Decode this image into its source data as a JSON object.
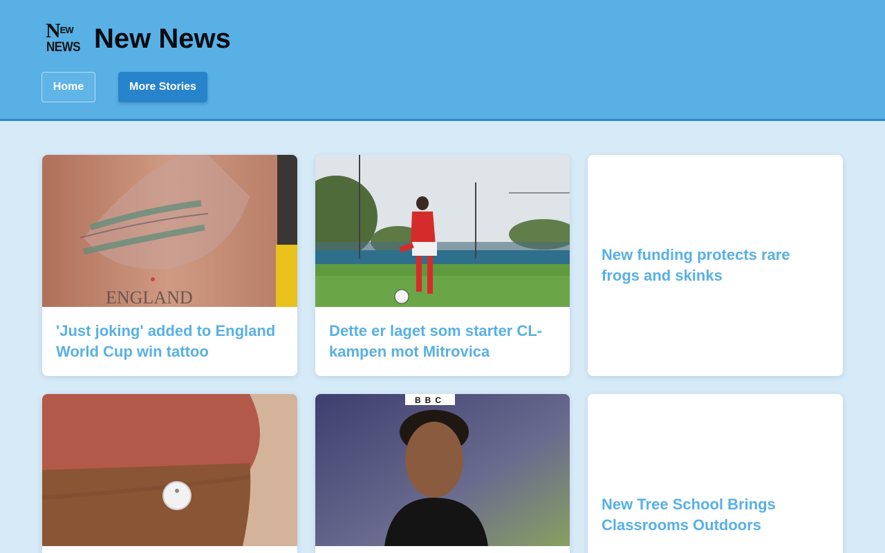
{
  "header": {
    "logo_line1_big": "N",
    "logo_line1_small": "EW",
    "logo_line2": "NEWS",
    "title": "New News",
    "nav": {
      "home_label": "Home",
      "more_label": "More Stories"
    }
  },
  "colors": {
    "header_bg": "#58b0e5",
    "page_bg": "#d6eaf8",
    "accent": "#2784cb",
    "headline": "#58b0e5"
  },
  "stories": [
    {
      "headline": "'Just joking' added to England World Cup win tattoo",
      "image": "arm-tattoo-photo",
      "image_text": "ENGLAND"
    },
    {
      "headline": "Dette er laget som starter CL-kampen mot Mitrovica",
      "image": "footballer-photo"
    },
    {
      "headline": "New funding protects rare frogs and skinks"
    },
    {
      "headline": "",
      "image": "arm-glucose-sensor-photo"
    },
    {
      "headline": "",
      "image": "football-manager-photo",
      "image_text": "BBC"
    },
    {
      "headline": "New Tree School Brings Classrooms Outdoors"
    }
  ]
}
